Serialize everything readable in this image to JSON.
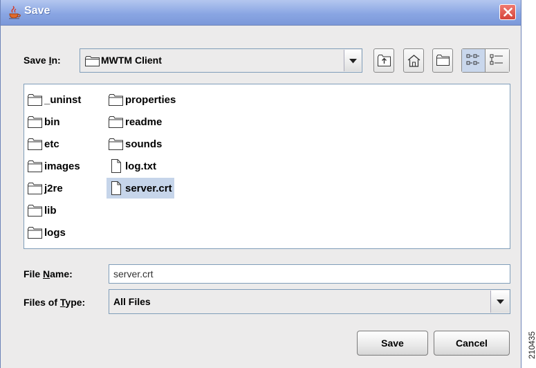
{
  "window": {
    "title": "Save",
    "close_icon": "close-x-icon",
    "accent_color": "#8aa6e3",
    "close_color": "#d5443a"
  },
  "save_in": {
    "label_pre": "Save ",
    "label_mnemonic": "I",
    "label_post": "n:",
    "value": "MWTM Client",
    "icon": "folder-icon"
  },
  "toolbar": {
    "buttons": [
      {
        "name": "up-one-level",
        "icon": "folder-up-icon"
      },
      {
        "name": "home",
        "icon": "home-icon"
      },
      {
        "name": "new-folder",
        "icon": "new-folder-icon"
      },
      {
        "name": "list-view",
        "icon": "list-view-icon",
        "selected": true
      },
      {
        "name": "details-view",
        "icon": "details-view-icon",
        "selected": false
      }
    ]
  },
  "files": {
    "items": [
      {
        "label": "_uninst",
        "type": "folder"
      },
      {
        "label": "bin",
        "type": "folder"
      },
      {
        "label": "etc",
        "type": "folder"
      },
      {
        "label": "images",
        "type": "folder"
      },
      {
        "label": "j2re",
        "type": "folder"
      },
      {
        "label": "lib",
        "type": "folder"
      },
      {
        "label": "logs",
        "type": "folder"
      },
      {
        "label": "properties",
        "type": "folder"
      },
      {
        "label": "readme",
        "type": "folder"
      },
      {
        "label": "sounds",
        "type": "folder"
      },
      {
        "label": "log.txt",
        "type": "file"
      },
      {
        "label": "server.crt",
        "type": "file",
        "selected": true
      }
    ],
    "selection_color": "#c6d5ea"
  },
  "file_name": {
    "label_pre": "File ",
    "label_mnemonic": "N",
    "label_post": "ame:",
    "value": "server.crt"
  },
  "file_type": {
    "label_pre": "Files of ",
    "label_mnemonic": "T",
    "label_post": "ype:",
    "value": "All Files"
  },
  "actions": {
    "save_label": "Save",
    "cancel_label": "Cancel"
  },
  "figure_id": "210435"
}
